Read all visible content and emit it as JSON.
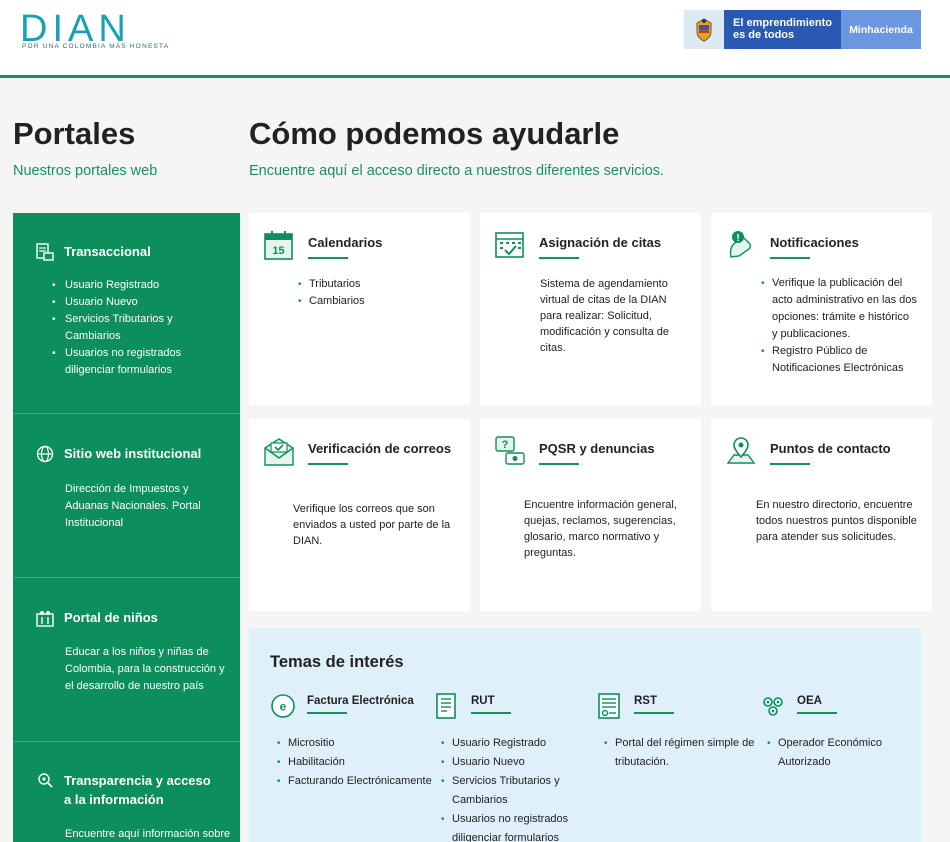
{
  "header": {
    "logo_word": "DIAN",
    "logo_tagline": "POR UNA COLOMBIA MÁS HONESTA",
    "gov_line1": "El emprendimiento",
    "gov_line2": "es de todos",
    "gov_ministry": "Minhacienda"
  },
  "portales": {
    "title": "Portales",
    "subtitle": "Nuestros portales web",
    "sections": [
      {
        "title": "Transaccional",
        "icon": "transaction-icon",
        "items": [
          "Usuario Registrado",
          "Usuario Nuevo",
          "Servicios Tributarios y Cambiarios",
          "Usuarios no registrados diligenciar formularios"
        ]
      },
      {
        "title": "Sitio web institucional",
        "icon": "globe-icon",
        "text": "Dirección de Impuestos y Aduanas Nacionales. Portal Institucional"
      },
      {
        "title": "Portal de niños",
        "icon": "kids-icon",
        "text": "Educar a los niños y niñas de Colombia, para la construcción y el desarrollo de nuestro país"
      },
      {
        "title": "Transparencia y acceso a la información",
        "icon": "transparency-icon",
        "text": "Encuentre aquí información sobre"
      }
    ]
  },
  "ayuda": {
    "title": "Cómo podemos ayudarle",
    "subtitle": "Encuentre aquí el acceso directo a nuestros diferentes servicios.",
    "cards": [
      {
        "title": "Calendarios",
        "icon": "calendar-icon",
        "items": [
          "Tributarios",
          "Cambiarios"
        ]
      },
      {
        "title": "Asignación de citas",
        "icon": "appointment-icon",
        "text": "Sistema de agendamiento virtual de citas de la DIAN para realizar: Solicitud, modificación y consulta de citas."
      },
      {
        "title": "Notificaciones",
        "icon": "notification-icon",
        "items": [
          "Verifique la publicación del acto administrativo en las dos opciones: trámite e histórico y publicaciones.",
          "Registro Público de Notificaciones Electrónicas"
        ]
      },
      {
        "title": "Verificación de correos",
        "icon": "email-verify-icon",
        "text": "Verifique los correos que son enviados a usted por parte de la DIAN."
      },
      {
        "title": "PQSR y denuncias",
        "icon": "pqsr-icon",
        "text": "Encuentre información general, quejas, reclamos, sugerencias, glosario, marco normativo y preguntas."
      },
      {
        "title": "Puntos de contacto",
        "icon": "location-icon",
        "text": "En nuestro directorio, encuentre todos nuestros puntos disponible para atender sus solicitudes."
      }
    ]
  },
  "temas": {
    "title": "Temas de interés",
    "items": [
      {
        "title": "Factura Electrónica",
        "icon": "invoice-icon",
        "items": [
          "Micrositio",
          "Habilitación",
          "Facturando Electrónicamente"
        ]
      },
      {
        "title": "RUT",
        "icon": "rut-icon",
        "items": [
          "Usuario Registrado",
          "Usuario Nuevo",
          "Servicios Tributarios y Cambiarios",
          "Usuarios no registrados diligenciar formularios"
        ]
      },
      {
        "title": "RST",
        "icon": "rst-icon",
        "items": [
          "Portal del régimen simple de tributación."
        ]
      },
      {
        "title": "OEA",
        "icon": "oea-icon",
        "items": [
          "Operador Económico Autorizado"
        ]
      }
    ]
  }
}
